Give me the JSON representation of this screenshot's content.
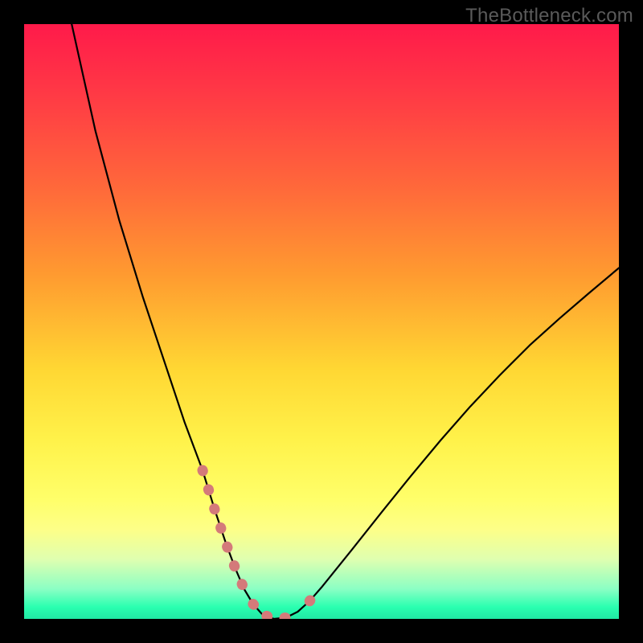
{
  "watermark": "TheBottleneck.com",
  "chart_data": {
    "type": "line",
    "title": "",
    "xlabel": "",
    "ylabel": "",
    "xlim": [
      0,
      100
    ],
    "ylim": [
      0,
      100
    ],
    "series": [
      {
        "name": "bottleneck-curve",
        "x": [
          8,
          12,
          16,
          20,
          24,
          27,
          30,
          32,
          34,
          35.5,
          37,
          38.5,
          40,
          42,
          44,
          46,
          48,
          50,
          55,
          60,
          65,
          70,
          75,
          80,
          85,
          90,
          95,
          100
        ],
        "values": [
          100,
          82,
          67,
          54,
          42,
          33,
          25,
          18.5,
          12.5,
          8.5,
          5,
          2.5,
          0.8,
          0,
          0.2,
          1.2,
          3,
          5.3,
          11.5,
          17.8,
          24,
          30,
          35.7,
          41,
          46,
          50.5,
          54.8,
          59
        ]
      }
    ],
    "highlight_segments": [
      {
        "name": "left-tail",
        "x": [
          30,
          32,
          34,
          35.5,
          37
        ],
        "values": [
          25,
          18.5,
          12.5,
          8.5,
          5
        ]
      },
      {
        "name": "trough",
        "x": [
          38.5,
          40,
          42,
          44,
          46
        ],
        "values": [
          2.5,
          0.8,
          0,
          0.2,
          1.2
        ]
      },
      {
        "name": "right-tail",
        "x": [
          48,
          50
        ],
        "values": [
          3,
          5.3
        ]
      }
    ],
    "colors": {
      "curve": "#000000",
      "highlight": "#d47a7a",
      "gradient_top": "#ff1a4a",
      "gradient_bottom": "#20e8a4",
      "frame": "#000000",
      "watermark": "#5a5a5a"
    }
  }
}
